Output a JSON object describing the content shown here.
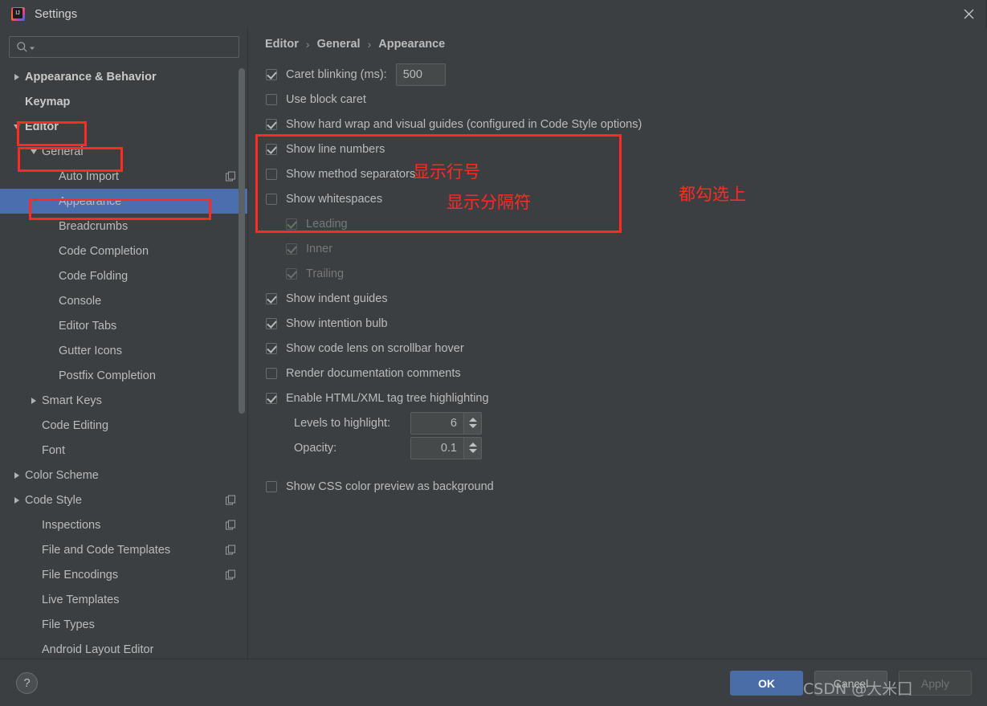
{
  "window": {
    "title": "Settings",
    "logo_icon": "intellij-idea-logo-icon",
    "close_icon": "close-icon"
  },
  "search": {
    "icon": "search-icon",
    "value": "",
    "placeholder": ""
  },
  "sidebar": {
    "items": [
      {
        "label": "Appearance & Behavior",
        "indent": 0,
        "twisty": "right",
        "bold": true,
        "selected": false,
        "copy": false
      },
      {
        "label": "Keymap",
        "indent": 0,
        "twisty": "none",
        "bold": true,
        "selected": false,
        "copy": false
      },
      {
        "label": "Editor",
        "indent": 0,
        "twisty": "down",
        "bold": true,
        "selected": false,
        "copy": false
      },
      {
        "label": "General",
        "indent": 1,
        "twisty": "down",
        "bold": false,
        "selected": false,
        "copy": false
      },
      {
        "label": "Auto Import",
        "indent": 2,
        "twisty": "none",
        "bold": false,
        "selected": false,
        "copy": true
      },
      {
        "label": "Appearance",
        "indent": 2,
        "twisty": "none",
        "bold": false,
        "selected": true,
        "copy": false
      },
      {
        "label": "Breadcrumbs",
        "indent": 2,
        "twisty": "none",
        "bold": false,
        "selected": false,
        "copy": false
      },
      {
        "label": "Code Completion",
        "indent": 2,
        "twisty": "none",
        "bold": false,
        "selected": false,
        "copy": false
      },
      {
        "label": "Code Folding",
        "indent": 2,
        "twisty": "none",
        "bold": false,
        "selected": false,
        "copy": false
      },
      {
        "label": "Console",
        "indent": 2,
        "twisty": "none",
        "bold": false,
        "selected": false,
        "copy": false
      },
      {
        "label": "Editor Tabs",
        "indent": 2,
        "twisty": "none",
        "bold": false,
        "selected": false,
        "copy": false
      },
      {
        "label": "Gutter Icons",
        "indent": 2,
        "twisty": "none",
        "bold": false,
        "selected": false,
        "copy": false
      },
      {
        "label": "Postfix Completion",
        "indent": 2,
        "twisty": "none",
        "bold": false,
        "selected": false,
        "copy": false
      },
      {
        "label": "Smart Keys",
        "indent": 1,
        "twisty": "right",
        "bold": false,
        "selected": false,
        "copy": false
      },
      {
        "label": "Code Editing",
        "indent": 1,
        "twisty": "none",
        "bold": false,
        "selected": false,
        "copy": false
      },
      {
        "label": "Font",
        "indent": 1,
        "twisty": "none",
        "bold": false,
        "selected": false,
        "copy": false
      },
      {
        "label": "Color Scheme",
        "indent": 0,
        "twisty": "right",
        "bold": false,
        "selected": false,
        "copy": false
      },
      {
        "label": "Code Style",
        "indent": 0,
        "twisty": "right",
        "bold": false,
        "selected": false,
        "copy": true
      },
      {
        "label": "Inspections",
        "indent": 1,
        "twisty": "none",
        "bold": false,
        "selected": false,
        "copy": true
      },
      {
        "label": "File and Code Templates",
        "indent": 1,
        "twisty": "none",
        "bold": false,
        "selected": false,
        "copy": true
      },
      {
        "label": "File Encodings",
        "indent": 1,
        "twisty": "none",
        "bold": false,
        "selected": false,
        "copy": true
      },
      {
        "label": "Live Templates",
        "indent": 1,
        "twisty": "none",
        "bold": false,
        "selected": false,
        "copy": false
      },
      {
        "label": "File Types",
        "indent": 1,
        "twisty": "none",
        "bold": false,
        "selected": false,
        "copy": false
      },
      {
        "label": "Android Layout Editor",
        "indent": 1,
        "twisty": "none",
        "bold": false,
        "selected": false,
        "copy": false
      }
    ]
  },
  "main": {
    "breadcrumb": {
      "parts": [
        "Editor",
        "General",
        "Appearance"
      ],
      "separator": "›"
    },
    "options": [
      {
        "label": "Caret blinking (ms):",
        "checked": true,
        "enabled": true,
        "indent": 0,
        "field": "500"
      },
      {
        "label": "Use block caret",
        "checked": false,
        "enabled": true,
        "indent": 0
      },
      {
        "label": "Show hard wrap and visual guides (configured in Code Style options)",
        "checked": true,
        "enabled": true,
        "indent": 0
      },
      {
        "label": "Show line numbers",
        "checked": true,
        "enabled": true,
        "indent": 0
      },
      {
        "label": "Show method separators",
        "checked": false,
        "enabled": true,
        "indent": 0
      },
      {
        "label": "Show whitespaces",
        "checked": false,
        "enabled": true,
        "indent": 0
      },
      {
        "label": "Leading",
        "checked": true,
        "enabled": false,
        "indent": 1
      },
      {
        "label": "Inner",
        "checked": true,
        "enabled": false,
        "indent": 1
      },
      {
        "label": "Trailing",
        "checked": true,
        "enabled": false,
        "indent": 1
      },
      {
        "label": "Show indent guides",
        "checked": true,
        "enabled": true,
        "indent": 0
      },
      {
        "label": "Show intention bulb",
        "checked": true,
        "enabled": true,
        "indent": 0
      },
      {
        "label": "Show code lens on scrollbar hover",
        "checked": true,
        "enabled": true,
        "indent": 0
      },
      {
        "label": "Render documentation comments",
        "checked": false,
        "enabled": true,
        "indent": 0
      },
      {
        "label": "Enable HTML/XML tag tree highlighting",
        "checked": true,
        "enabled": true,
        "indent": 0
      }
    ],
    "spinners": [
      {
        "label": "Levels to highlight:",
        "value": "6"
      },
      {
        "label": "Opacity:",
        "value": "0.1"
      }
    ],
    "last_option": {
      "label": "Show CSS color preview as background",
      "checked": false
    }
  },
  "footer": {
    "help_label": "?",
    "ok_label": "OK",
    "cancel_label": "Cancel",
    "apply_label": "Apply"
  },
  "annotations": {
    "color": "#FF2A22",
    "line_numbers_note": "显示行号",
    "separators_note": "显示分隔符",
    "check_all_note": "都勾选上"
  },
  "watermark": {
    "text": "CSDN @大米囗"
  }
}
